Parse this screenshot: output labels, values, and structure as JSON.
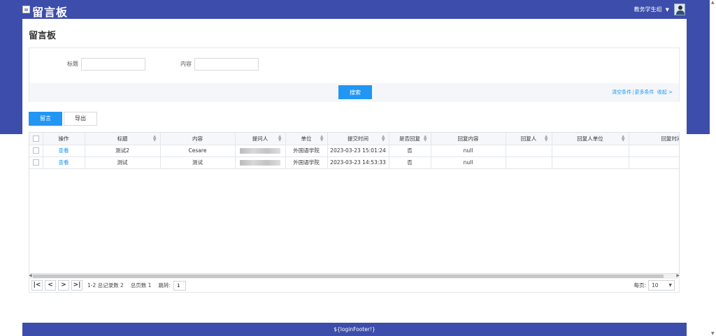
{
  "header": {
    "title": "留言板",
    "user_name": "教务学生组",
    "caret_icon": "chevron-down-icon",
    "avatar_icon": "user-avatar-icon"
  },
  "page": {
    "title": "留言板"
  },
  "search": {
    "title_label": "标题",
    "title_value": "",
    "content_label": "内容",
    "content_value": "",
    "search_button": "搜索",
    "clear_link": "清空条件",
    "separator": "|",
    "more_link": "更多条件",
    "collapse_link": "收起 >"
  },
  "tabs": [
    {
      "label": "留言",
      "active": true
    },
    {
      "label": "导出",
      "active": false
    }
  ],
  "table": {
    "columns": [
      "操作",
      "标题",
      "内容",
      "提问人",
      "单位",
      "提交时间",
      "是否回复",
      "回复内容",
      "回复人",
      "回复人单位",
      "回复时间"
    ],
    "rows": [
      {
        "action": "查看",
        "title": "测试2",
        "content": "Cesare",
        "asker": "",
        "unit": "外国语学院",
        "submit_time": "2023-03-23 15:01:24",
        "replied": "否",
        "reply_content": "null",
        "replier": "",
        "replier_unit": "",
        "reply_time": ""
      },
      {
        "action": "查看",
        "title": "测试",
        "content": "测试",
        "asker": "",
        "unit": "外国语学院",
        "submit_time": "2023-03-23 14:53:33",
        "replied": "否",
        "reply_content": "null",
        "replier": "",
        "replier_unit": "",
        "reply_time": ""
      }
    ]
  },
  "pager": {
    "first": "|<",
    "prev": "<",
    "next": ">",
    "last": ">|",
    "records": "1-2 总记录数 2",
    "total_pages": "总页数 1",
    "jump_label": "跳转:",
    "jump_value": "1",
    "per_page_label": "每页:",
    "per_page_value": "10"
  },
  "footer": {
    "text": "${loginFooter!}"
  },
  "colors": {
    "brand": "#3c4dab",
    "accent": "#2196f3"
  }
}
